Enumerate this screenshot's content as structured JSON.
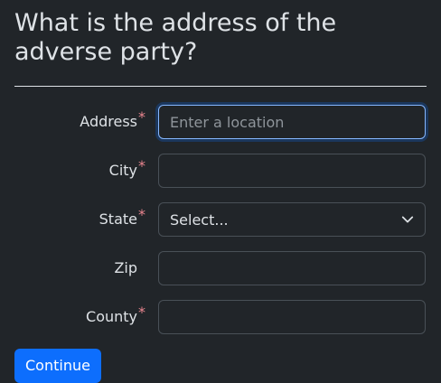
{
  "page": {
    "title": "What is the address of the adverse party?"
  },
  "form": {
    "required_mark": "*",
    "address": {
      "label": "Address",
      "placeholder": "Enter a location",
      "value": ""
    },
    "city": {
      "label": "City",
      "value": ""
    },
    "state": {
      "label": "State",
      "selected": "Select..."
    },
    "zip": {
      "label": "Zip",
      "value": ""
    },
    "county": {
      "label": "County",
      "value": ""
    }
  },
  "actions": {
    "continue_label": "Continue"
  },
  "colors": {
    "background": "#212529",
    "text": "#dee2e6",
    "required": "#ea868f",
    "accent": "#0d6efd",
    "focus_border": "#86b7fe"
  }
}
